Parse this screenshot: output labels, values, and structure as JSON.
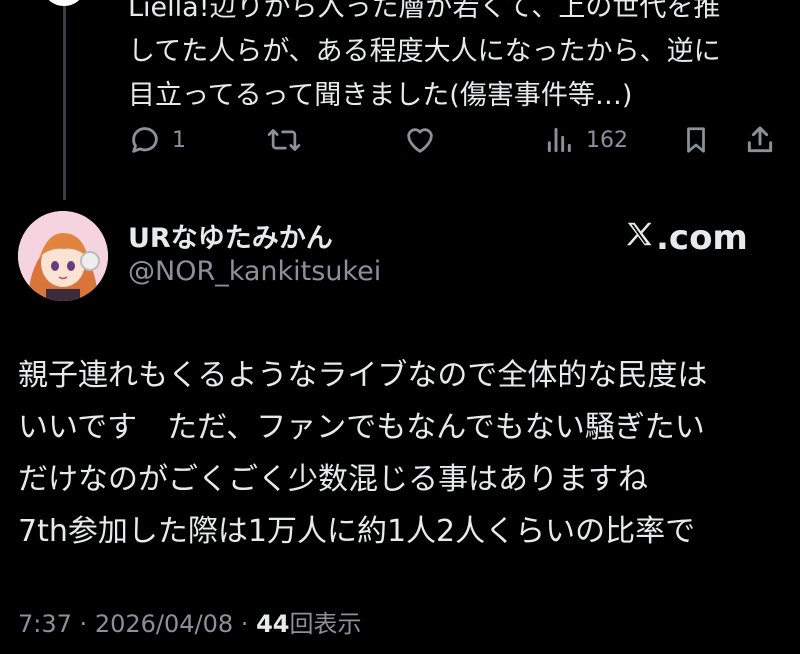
{
  "parent_tweet": {
    "text_lines": [
      "Liella!辺りから入った層が若くて、上の世代を推",
      "してた人らが、ある程度大人になったから、逆に",
      "目立ってるって聞きました(傷害事件等…)"
    ],
    "actions": {
      "reply_count": "1",
      "retweet_count": "",
      "like_count": "",
      "views_count": "162"
    }
  },
  "tweet": {
    "author": {
      "display_name": "URなゆたみかん",
      "handle": "@NOR_kankitsukei"
    },
    "brand_label": ".com",
    "text_lines": [
      "親子連れもくるようなライブなので全体的な民度は",
      "いいです　ただ、ファンでもなんでもない騒ぎたい",
      "だけなのがごくごく少数混じる事はありますね",
      "7th参加した際は1万人に約1人2人くらいの比率で"
    ],
    "meta": {
      "time": "7:37",
      "separator": "·",
      "date": "2026/04/08",
      "views_count": "44",
      "views_label": "回表示"
    }
  },
  "colors": {
    "background": "#000000",
    "primary_text": "#e7e9ea",
    "secondary_text": "#8b9198",
    "thread_line": "#3a3d41"
  }
}
